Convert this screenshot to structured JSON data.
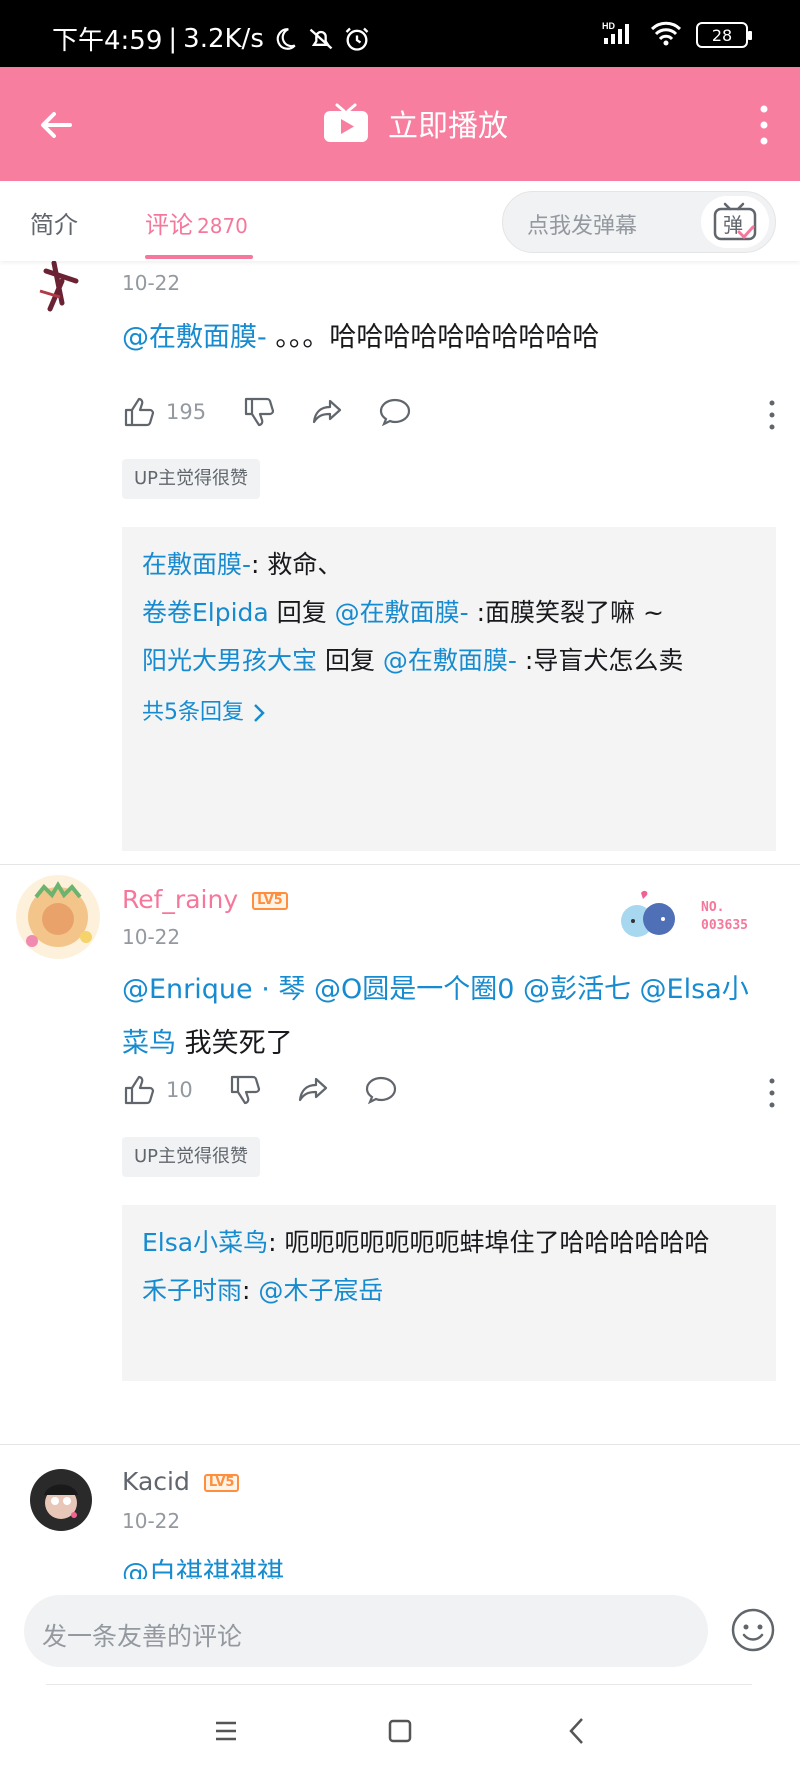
{
  "status_bar": {
    "time": "下午4:59",
    "speed": "3.2K/s",
    "battery": "28",
    "signal_label": "HD"
  },
  "header": {
    "title": "立即播放"
  },
  "tabs": {
    "intro": "简介",
    "comments": "评论",
    "comments_count": "2870",
    "danmaku_placeholder": "点我发弹幕",
    "danmaku_icon_text": "弹"
  },
  "comments": [
    {
      "date": "10-22",
      "mention": "@在敷面膜-",
      "text": " 。。。哈哈哈哈哈哈哈哈哈哈",
      "likes": "195",
      "up_badge": "UP主觉得很赞",
      "replies": [
        {
          "name": "在敷面膜-",
          "sep": ": ",
          "text": "救命、"
        },
        {
          "name": "卷卷Elpida",
          "sep": " 回复 ",
          "mention": "@在敷面膜-",
          "text": " :面膜笑裂了嘛 ~"
        },
        {
          "name": "阳光大男孩大宝",
          "sep": " 回复 ",
          "mention": "@在敷面膜-",
          "text": " :导盲犬怎么卖"
        }
      ],
      "more_replies": "共5条回复"
    },
    {
      "username": "Ref_rainy",
      "level": "LV5",
      "date": "10-22",
      "fan_no_label": "NO.",
      "fan_no": "003635",
      "mentions": "@Enrique · 琴 @O圆是一个圈0 @彭活七 @Elsa小菜鸟",
      "text": " 我笑死了",
      "likes": "10",
      "up_badge": "UP主觉得很赞",
      "replies": [
        {
          "name": "Elsa小菜鸟",
          "sep": ": ",
          "text": "呃呃呃呃呃呃呃蚌埠住了哈哈哈哈哈哈"
        },
        {
          "name": "禾子时雨",
          "sep": ": ",
          "mention": "@木子宸岳",
          "text": ""
        }
      ]
    },
    {
      "username": "Kacid",
      "level": "LV5",
      "date": "10-22",
      "mention_partial": "@白祺祺祺祺"
    }
  ],
  "bottom": {
    "input_placeholder": "发一条友善的评论"
  },
  "colors": {
    "header_pink": "#f87e9f",
    "accent_pink": "#f5789c",
    "link_blue": "#178bcf",
    "level_orange": "#ff8f3e"
  }
}
